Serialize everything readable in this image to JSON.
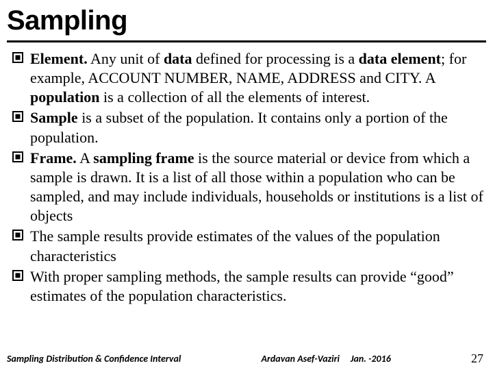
{
  "title": "Sampling",
  "bullets": [
    "<b>Element.</b> Any unit of <b>data</b> defined for processing is a <b>data element</b>; for example, ACCOUNT NUMBER, NAME, ADDRESS and CITY. A <b>population</b> is a collection of all the elements of interest.",
    "<b>Sample</b> is a subset of the population. It contains only a portion of the population.",
    "<b>Frame.</b> A <b>sampling frame</b> is the source material or device from which a sample is drawn. It is a list of all those within a population who can be sampled, and may include individuals, households or institutions is a list of objects",
    "The sample results provide estimates of the values of the population characteristics",
    "With proper sampling methods, the sample results can provide “good” estimates of the population characteristics."
  ],
  "footer": {
    "left": "Sampling Distribution & Confidence Interval",
    "author": "Ardavan Asef-Vaziri",
    "date": "Jan. -2016",
    "page": "27"
  }
}
